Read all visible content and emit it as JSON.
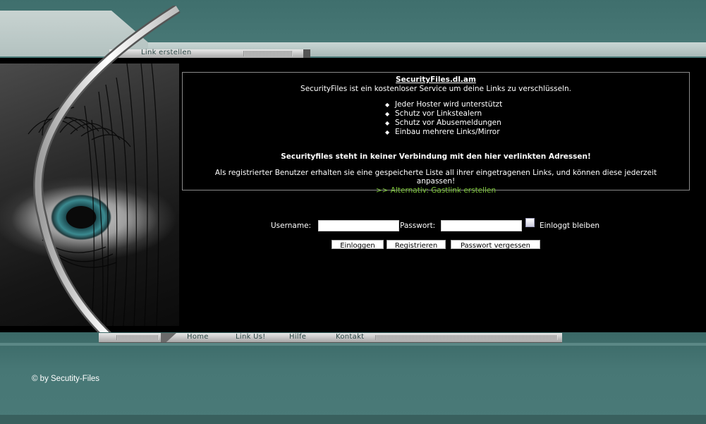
{
  "header": {
    "nav_link": "Link erstellen"
  },
  "info": {
    "title": "SecurityFiles.dl.am",
    "description": "SecurityFiles ist ein kostenloser Service um deine Links zu verschlüsseln.",
    "features": [
      "Jeder Hoster wird unterstützt",
      "Schutz vor Linkstealern",
      "Schutz vor Abusemeldungen",
      "Einbau mehrere Links/Mirror"
    ],
    "disclaimer": "Securityfiles steht in keiner Verbindung mit den hier verlinkten Adressen!",
    "registered_text": "Als registrierter Benutzer erhalten sie eine gespeicherte Liste all ihrer eingetragenen Links, und können diese jederzeit anpassen!",
    "guest_link": ">> Alternativ: Gastlink erstellen"
  },
  "login": {
    "username_label": "Username:",
    "username_value": "",
    "password_label": "Passwort:",
    "password_value": "",
    "remember_label": "Einloggt bleiben",
    "remember_checked": false,
    "login_button": "Einloggen",
    "register_button": "Registrieren",
    "forgot_button": "Passwort vergessen"
  },
  "footer_nav": {
    "home": "Home",
    "link_us": "Link Us!",
    "help": "Hilfe",
    "contact": "Kontakt"
  },
  "copyright": "© by Secutity-Files",
  "colors": {
    "teal": "#467775",
    "black": "#000000",
    "link_green": "#7ec83a"
  }
}
